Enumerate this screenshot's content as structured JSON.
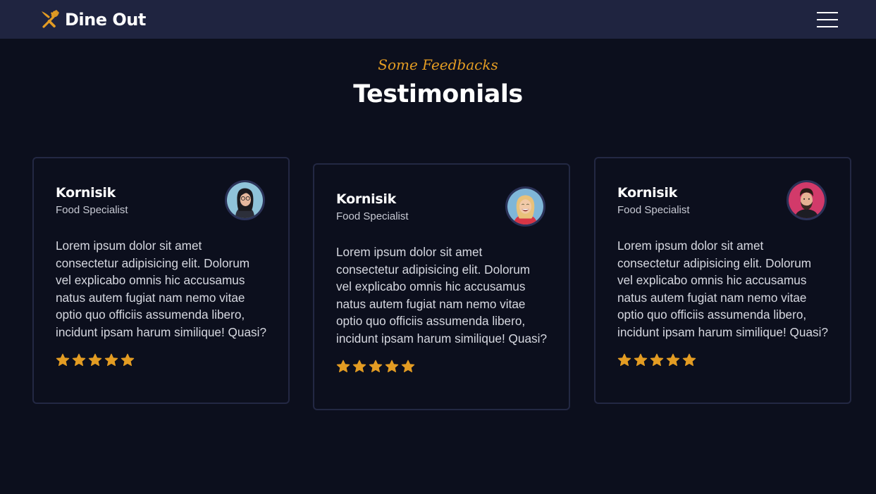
{
  "nav": {
    "brand": "Dine Out",
    "brand_icon": "fork-knife-icon",
    "menu_icon": "hamburger-menu-icon"
  },
  "section": {
    "subtitle": "Some Feedbacks",
    "title": "Testimonials"
  },
  "colors": {
    "accent": "#e39c23",
    "background": "#0c0f1d",
    "navbar": "#1f2440",
    "card_border": "#232843"
  },
  "testimonials": [
    {
      "name": "Kornisik",
      "role": "Food Specialist",
      "avatar": "woman-with-glasses-avatar",
      "quote": "Lorem ipsum dolor sit amet consectetur adipisicing elit. Dolorum vel explicabo omnis hic accusamus natus autem fugiat nam nemo vitae optio quo officiis assumenda libero, incidunt ipsam harum similique! Quasi?",
      "rating": 5
    },
    {
      "name": "Kornisik",
      "role": "Food Specialist",
      "avatar": "laughing-woman-avatar",
      "quote": "Lorem ipsum dolor sit amet consectetur adipisicing elit. Dolorum vel explicabo omnis hic accusamus natus autem fugiat nam nemo vitae optio quo officiis assumenda libero, incidunt ipsam harum similique! Quasi?",
      "rating": 5
    },
    {
      "name": "Kornisik",
      "role": "Food Specialist",
      "avatar": "bearded-man-avatar",
      "quote": "Lorem ipsum dolor sit amet consectetur adipisicing elit. Dolorum vel explicabo omnis hic accusamus natus autem fugiat nam nemo vitae optio quo officiis assumenda libero, incidunt ipsam harum similique! Quasi?",
      "rating": 5
    }
  ]
}
